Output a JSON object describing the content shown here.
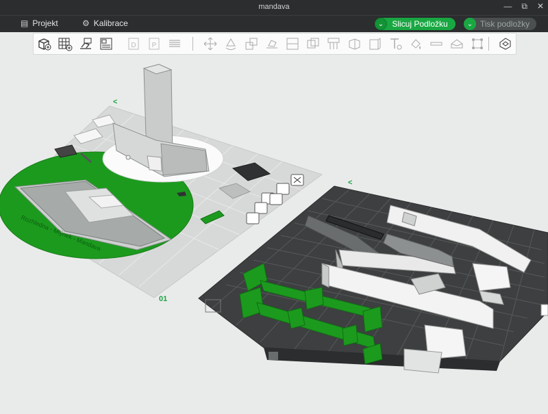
{
  "window": {
    "title": "mandava",
    "controls": [
      "—",
      "⧉",
      "✕"
    ]
  },
  "menu": {
    "project_label": "Projekt",
    "calibration_label": "Kalibrace",
    "slice_label": "Slicuj Podložku",
    "print_label": "Tisk podložky"
  },
  "toolbar": {
    "tools": [
      "add-object",
      "add-plate",
      "auto-orient",
      "arrange",
      "plate-d",
      "plate-p",
      "layers",
      "move",
      "rotate",
      "scale",
      "lay-on-face",
      "split",
      "boolean",
      "support",
      "cut",
      "measure",
      "text",
      "paint",
      "seam",
      "emboss",
      "assembly",
      "variable-layer"
    ]
  },
  "plates": {
    "left_number": "01",
    "plate_marker": "<"
  },
  "colors": {
    "accent": "#19a742",
    "titlebar": "#2b2d2e",
    "dark_plate": "#3c3e3f",
    "light_plate": "#d9dbda"
  }
}
